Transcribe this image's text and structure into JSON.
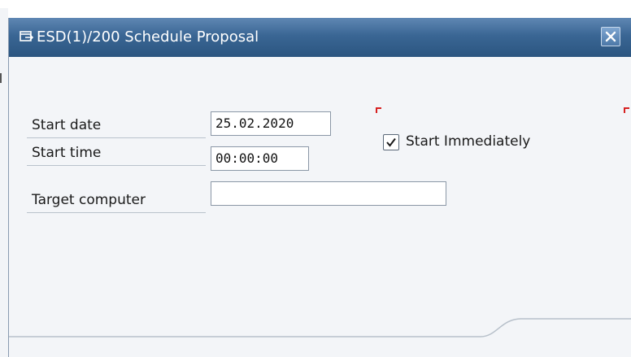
{
  "window": {
    "title": "ESD(1)/200 Schedule Proposal",
    "title_icon": "dialog-window-icon",
    "close_icon": "close-icon"
  },
  "form": {
    "start_date": {
      "label": "Start date",
      "value": "25.02.2020"
    },
    "start_time": {
      "label": "Start time",
      "value": "00:00:00"
    },
    "target_computer": {
      "label": "Target computer",
      "value": ""
    },
    "start_immediately": {
      "label": "Start Immediately",
      "checked": true
    }
  },
  "colors": {
    "titlebar": "#3a6694",
    "required_mark": "#d62020",
    "dialog_background": "#f3f5f8"
  }
}
